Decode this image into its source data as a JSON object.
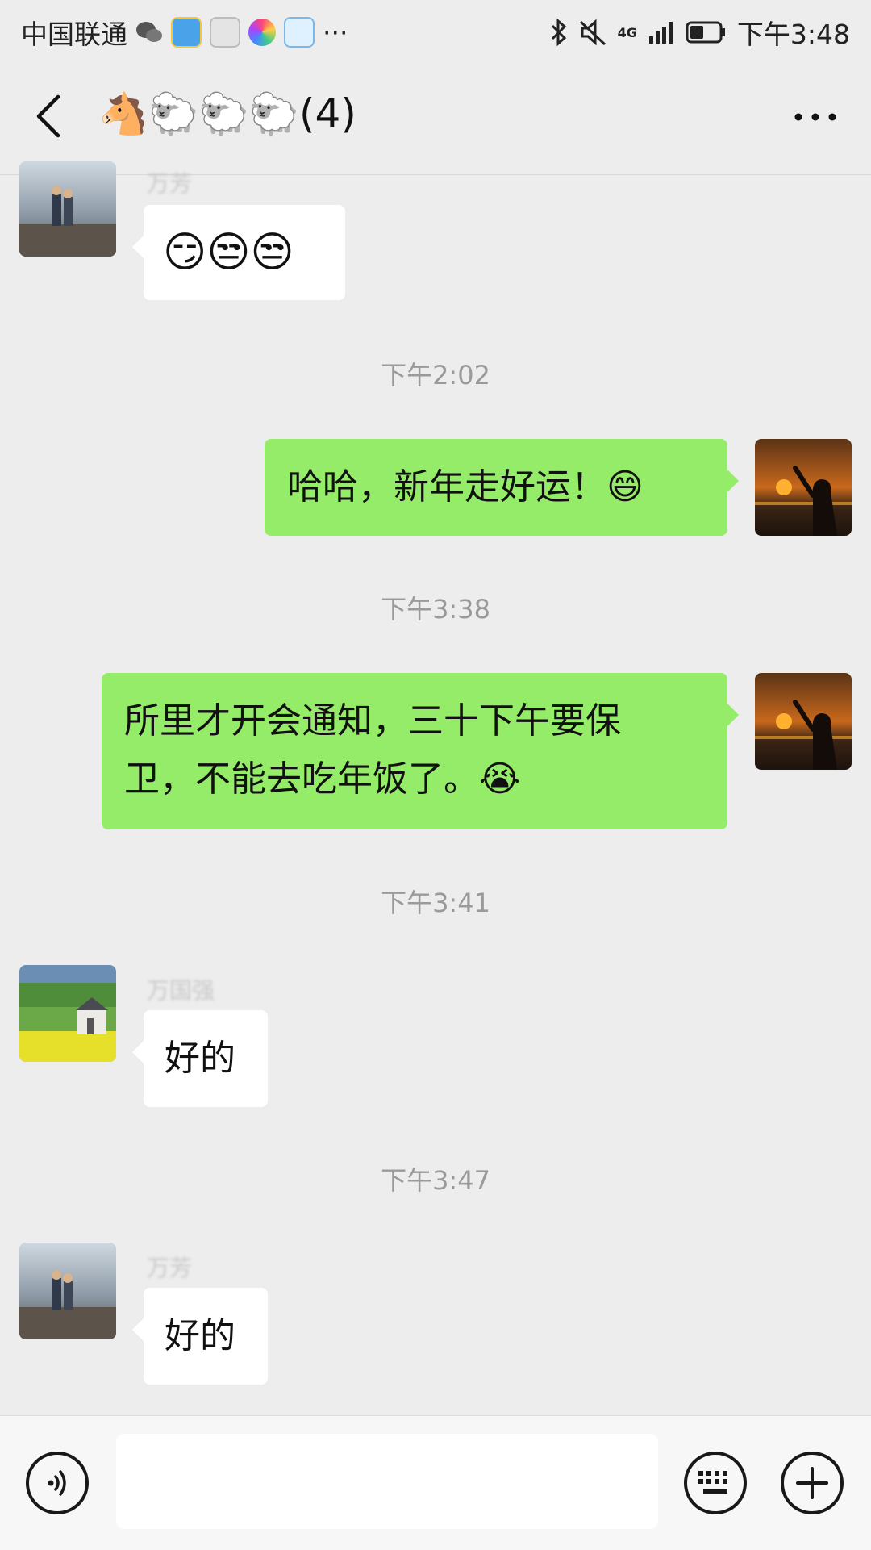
{
  "status_bar": {
    "carrier": "中国联通",
    "more": "···",
    "network_label": "4G",
    "time": "下午3:48",
    "icons": [
      "wechat-icon",
      "messenger-app-icon",
      "app-icon",
      "colorful-app-icon",
      "cartoon-app-icon",
      "bluetooth-icon",
      "mute-icon",
      "signal-icon",
      "battery-icon"
    ]
  },
  "header": {
    "title": "🐴🐑🐑🐑(4)",
    "back_icon": "chevron-left-icon",
    "more_icon": "more-dots-icon"
  },
  "messages": [
    {
      "type": "incoming",
      "sender": "万芳",
      "text": "😏😒😒"
    },
    {
      "type": "time",
      "text": "下午2:02"
    },
    {
      "type": "outgoing",
      "text": "哈哈，新年走好运！😄"
    },
    {
      "type": "time",
      "text": "下午3:38"
    },
    {
      "type": "outgoing",
      "lines": [
        "所里才开会通知，三十下午要保",
        "卫，不能去吃年饭了。😭"
      ]
    },
    {
      "type": "time",
      "text": "下午3:41"
    },
    {
      "type": "incoming",
      "sender": "万国强",
      "text": "好的"
    },
    {
      "type": "time",
      "text": "下午3:47"
    },
    {
      "type": "incoming",
      "sender": "万芳",
      "text": "好的"
    }
  ],
  "input": {
    "value": "",
    "placeholder": ""
  },
  "colors": {
    "background": "#ededed",
    "outgoing_bubble": "#95ec69",
    "incoming_bubble": "#ffffff"
  }
}
